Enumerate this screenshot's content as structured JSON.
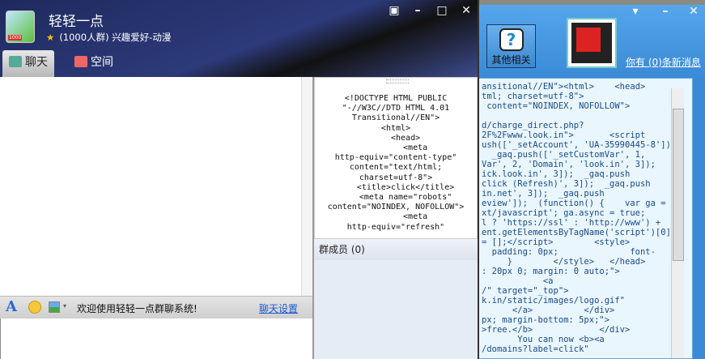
{
  "back_window": {
    "buttons": {
      "menu": "▾",
      "minimize": "–",
      "close": "✕"
    },
    "other_button": "其他相关",
    "new_message_link": "你有 (0)条新消息",
    "code_lines": [
      "ansitional//EN\"><html>    <head>",
      "tml; charset=utf-8\">",
      " content=\"NOINDEX, NOFOLLOW\">",
      "",
      "d/charge_direct.php?",
      "2F%2Fwww.look.in\">       <script",
      "ush(['_setAccount', 'UA-35990445-8']);",
      "  _gaq.push(['_setCustomVar', 1,",
      "Var', 2, 'Domain', 'look.in', 3]);",
      "ick.look.in', 3]);  _gaq.push",
      "click (Refresh)', 3]);  _gaq.push",
      "in.net', 3]);  _gaq.push",
      "eview']);  (function() {    var ga =",
      "xt/javascript'; ga.async = true;",
      "l ? 'https://ssl' : 'http://www') +",
      "ent.getElementsByTagName('script')[0];",
      "= [];</script>        <style>",
      "  padding: 0px;              font-",
      "     }        </style>   </head>",
      ": 20px 0; margin: 0 auto;\">",
      "            <a",
      "/\" target=\"_top\">",
      "k.in/static/images/logo.gif\"",
      "      </a>          </div>",
      "px; margin-bottom: 5px;\">",
      ">free.</b>             </div>",
      "       You can now <b><a",
      "/domains?label=click\""
    ]
  },
  "header": {
    "title": "轻轻一点",
    "avatar_badge": "1000",
    "subtitle": "(1000人群) 兴趣爱好-动漫",
    "controls": {
      "skin": "▣",
      "minimize": "–",
      "maximize": "□",
      "close": "✕"
    },
    "tabs": [
      {
        "label": "聊天",
        "active": true
      },
      {
        "label": "空间",
        "active": false
      }
    ]
  },
  "toolbar": {
    "welcome": "欢迎使用轻轻一点群聊系统!",
    "settings_link": "聊天设置",
    "font_icon": "A",
    "dropdown": "▾"
  },
  "announcement": "<!DOCTYPE HTML PUBLIC \"-//W3C//DTD HTML 4.01 Transitional//EN\">\n<html>\n    <head>\n        <meta\nhttp-equiv=\"content-type\"\ncontent=\"text/html;\ncharset=utf-8\">\n    <title>click</title>\n    <meta name=\"robots\"\ncontent=\"NOINDEX, NOFOLLOW\">\n        <meta\nhttp-equiv=\"refresh\"",
  "members": {
    "label": "群成员 (0)"
  }
}
